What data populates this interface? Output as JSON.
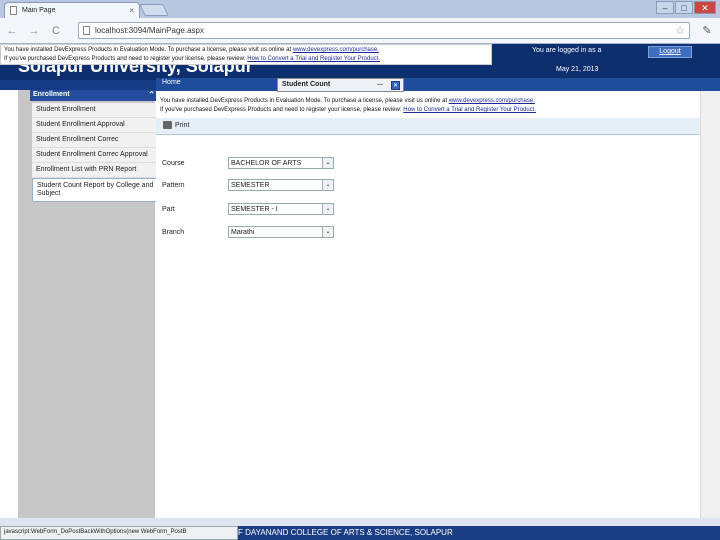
{
  "browser": {
    "tab_title": "Main Page",
    "tab_close": "×",
    "url": "localhost:3094/MainPage.aspx",
    "back": "←",
    "forward": "→",
    "reload": "C",
    "star": "☆",
    "wrench": "✎",
    "minimize": "–",
    "maximize": "□",
    "close": "✕"
  },
  "header": {
    "app_title": "Solapur University, Solapur",
    "logged_in_text": "You are logged in as a",
    "date": "May 21, 2013",
    "logout_label": "Logout"
  },
  "eval_banner": {
    "line1_text": "You have installed DevExpress Products in Evaluation Mode. To purchase a license, please visit us online at ",
    "line1_link": "www.devexpress.com/purchase.",
    "line2_text": "If you've purchased DevExpress Products and need to register your license, please review: ",
    "line2_link": "How to Convert a Trial and Register Your Product."
  },
  "sidebar": {
    "header": "Enrollment",
    "collapse_icon": "⌃",
    "items": [
      {
        "label": "Student Enrollment"
      },
      {
        "label": "Student Enrollment Approval"
      },
      {
        "label": "Student Enrollment Correc"
      },
      {
        "label": "Student Enrollment Correc Approval"
      },
      {
        "label": "Enrollment List with PRN Report"
      },
      {
        "label": "Student Count Report by College and Subject"
      }
    ]
  },
  "main": {
    "nav_home": "Home",
    "tab_label": "Student Count",
    "tab_more": "...",
    "tab_close": "×",
    "print_label": "Print",
    "form": [
      {
        "label": "Course",
        "value": "BACHELOR OF ARTS",
        "arrow": "⌄"
      },
      {
        "label": "Pattern",
        "value": "SEMESTER",
        "arrow": "⌄"
      },
      {
        "label": "Part",
        "value": "SEMESTER - I",
        "arrow": "⌄"
      },
      {
        "label": "Branch",
        "value": "Marathi",
        "arrow": "⌄"
      }
    ]
  },
  "status_bar": {
    "text": "javascript:WebForm_DoPostBackWithOptions(new WebForm_PostB"
  },
  "footer": {
    "text": "F DAYANAND COLLEGE OF ARTS & SCIENCE, SOLAPUR"
  }
}
